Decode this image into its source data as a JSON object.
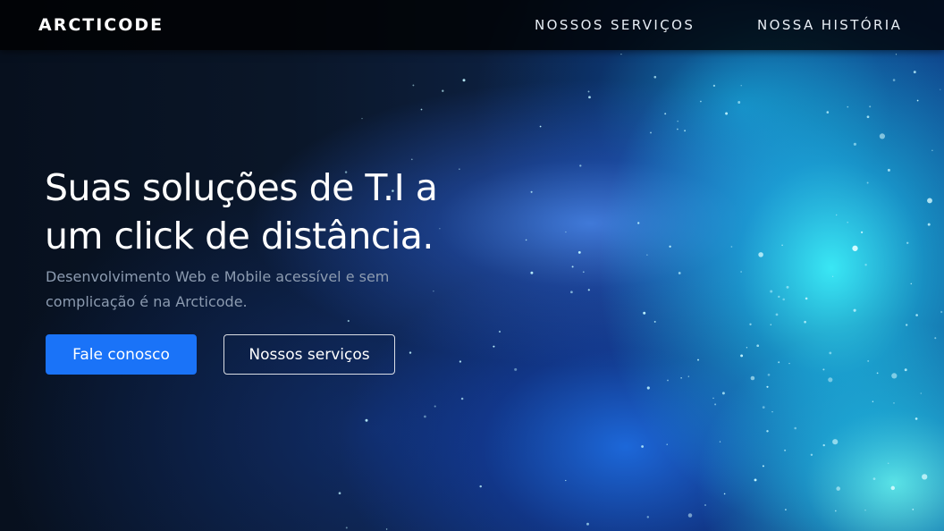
{
  "navbar": {
    "brand": "ARCTICODE",
    "links": [
      {
        "label": "NOSSOS SERVIÇOS"
      },
      {
        "label": "NOSSA HISTÓRIA"
      }
    ]
  },
  "hero": {
    "title_line1": "Suas soluções de T.I a",
    "title_line2": "um click de distância.",
    "subtitle_line1": "Desenvolvimento Web e Mobile acessível e sem",
    "subtitle_line2": "complicação é na Arcticode.",
    "primary_button": "Fale conosco",
    "secondary_button": "Nossos serviços"
  },
  "colors": {
    "primary_button": "#1a73f8",
    "navbar_background": "#000000",
    "aurora_cyan": "#3cf0fa",
    "subtitle_text": "#8c9bb0"
  }
}
